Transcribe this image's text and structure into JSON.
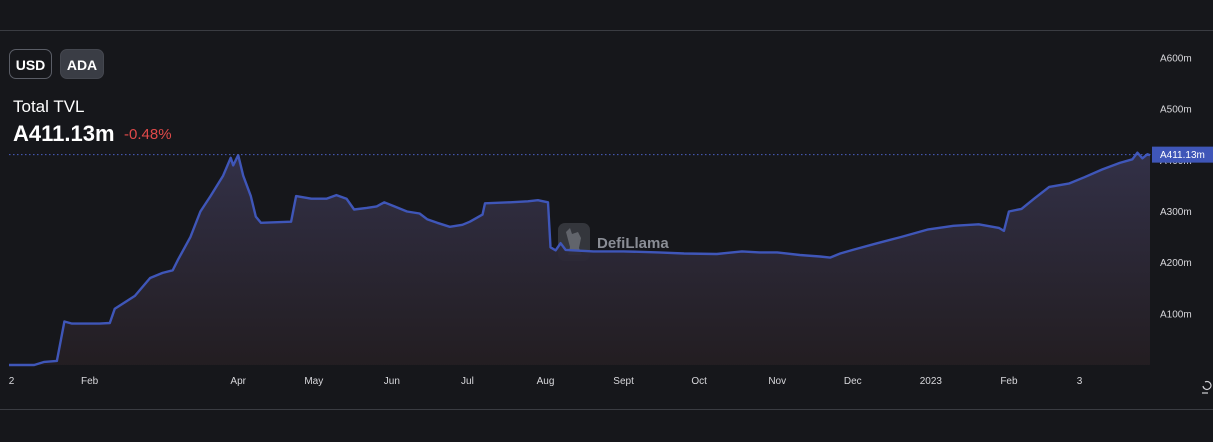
{
  "toggles": {
    "usd_label": "USD",
    "ada_label": "ADA"
  },
  "header": {
    "title": "Total TVL",
    "value": "A411.13m",
    "change": "-0.48%"
  },
  "watermark": {
    "text": "DefiLlama",
    "icon": "llama-icon"
  },
  "colors": {
    "line": "#3f56b8",
    "accent": "#3f56b8",
    "negative": "#e04a4a",
    "background": "#16171b"
  },
  "chart_data": {
    "type": "area",
    "title": "Total TVL",
    "ylabel": "",
    "xlabel": "",
    "ylim": [
      0,
      600
    ],
    "y_unit": "A_m",
    "y_ticks": [
      "A100m",
      "A200m",
      "A300m",
      "A400m",
      "A500m",
      "A600m"
    ],
    "y_tick_values": [
      100,
      200,
      300,
      400,
      500,
      600
    ],
    "x_ticks": [
      "2",
      "Feb",
      "Apr",
      "May",
      "Jun",
      "Jul",
      "Aug",
      "Sept",
      "Oct",
      "Nov",
      "Dec",
      "2023",
      "Feb",
      "3"
    ],
    "x_tick_dates": [
      "2022-01-01",
      "2022-02-01",
      "2022-04-01",
      "2022-05-01",
      "2022-06-01",
      "2022-07-01",
      "2022-08-01",
      "2022-09-01",
      "2022-10-01",
      "2022-11-01",
      "2022-12-01",
      "2023-01-01",
      "2023-02-01",
      "2023-03-01"
    ],
    "last_value_label": "A411.13m",
    "last_value": 411.13,
    "grid": false,
    "series": [
      {
        "name": "Total TVL",
        "points": [
          [
            "2021-12-31",
            0
          ],
          [
            "2022-01-10",
            0
          ],
          [
            "2022-01-14",
            6
          ],
          [
            "2022-01-19",
            8
          ],
          [
            "2022-01-22",
            85
          ],
          [
            "2022-01-25",
            81
          ],
          [
            "2022-02-05",
            81
          ],
          [
            "2022-02-09",
            82
          ],
          [
            "2022-02-11",
            110
          ],
          [
            "2022-02-19",
            135
          ],
          [
            "2022-02-25",
            170
          ],
          [
            "2022-03-02",
            180
          ],
          [
            "2022-03-06",
            185
          ],
          [
            "2022-03-08",
            205
          ],
          [
            "2022-03-13",
            250
          ],
          [
            "2022-03-17",
            300
          ],
          [
            "2022-03-21",
            330
          ],
          [
            "2022-03-26",
            370
          ],
          [
            "2022-03-29",
            405
          ],
          [
            "2022-03-30",
            390
          ],
          [
            "2022-04-01",
            410
          ],
          [
            "2022-04-03",
            370
          ],
          [
            "2022-04-06",
            330
          ],
          [
            "2022-04-08",
            290
          ],
          [
            "2022-04-10",
            278
          ],
          [
            "2022-04-22",
            280
          ],
          [
            "2022-04-24",
            330
          ],
          [
            "2022-04-30",
            325
          ],
          [
            "2022-05-06",
            325
          ],
          [
            "2022-05-10",
            332
          ],
          [
            "2022-05-14",
            325
          ],
          [
            "2022-05-17",
            304
          ],
          [
            "2022-05-22",
            307
          ],
          [
            "2022-05-26",
            310
          ],
          [
            "2022-05-29",
            318
          ],
          [
            "2022-06-02",
            310
          ],
          [
            "2022-06-07",
            300
          ],
          [
            "2022-06-12",
            296
          ],
          [
            "2022-06-15",
            285
          ],
          [
            "2022-06-19",
            278
          ],
          [
            "2022-06-24",
            270
          ],
          [
            "2022-06-29",
            274
          ],
          [
            "2022-07-02",
            280
          ],
          [
            "2022-07-07",
            294
          ],
          [
            "2022-07-08",
            316
          ],
          [
            "2022-07-18",
            318
          ],
          [
            "2022-07-25",
            320
          ],
          [
            "2022-07-29",
            322
          ],
          [
            "2022-08-02",
            318
          ],
          [
            "2022-08-03",
            230
          ],
          [
            "2022-08-05",
            224
          ],
          [
            "2022-08-07",
            238
          ],
          [
            "2022-08-09",
            225
          ],
          [
            "2022-08-20",
            222
          ],
          [
            "2022-09-01",
            222
          ],
          [
            "2022-09-15",
            220
          ],
          [
            "2022-09-25",
            218
          ],
          [
            "2022-10-08",
            217
          ],
          [
            "2022-10-18",
            222
          ],
          [
            "2022-10-25",
            220
          ],
          [
            "2022-11-01",
            220
          ],
          [
            "2022-11-10",
            215
          ],
          [
            "2022-11-18",
            212
          ],
          [
            "2022-11-22",
            210
          ],
          [
            "2022-11-26",
            218
          ],
          [
            "2022-12-01",
            225
          ],
          [
            "2022-12-10",
            237
          ],
          [
            "2022-12-20",
            250
          ],
          [
            "2022-12-31",
            265
          ],
          [
            "2023-01-10",
            272
          ],
          [
            "2023-01-20",
            275
          ],
          [
            "2023-01-28",
            268
          ],
          [
            "2023-01-30",
            262
          ],
          [
            "2023-02-01",
            300
          ],
          [
            "2023-02-06",
            305
          ],
          [
            "2023-02-11",
            325
          ],
          [
            "2023-02-17",
            348
          ],
          [
            "2023-02-25",
            355
          ],
          [
            "2023-03-03",
            367
          ],
          [
            "2023-03-10",
            382
          ],
          [
            "2023-03-17",
            395
          ],
          [
            "2023-03-22",
            402
          ],
          [
            "2023-03-24",
            415
          ],
          [
            "2023-03-26",
            404
          ],
          [
            "2023-03-28",
            412
          ],
          [
            "2023-03-29",
            410
          ]
        ]
      }
    ]
  }
}
